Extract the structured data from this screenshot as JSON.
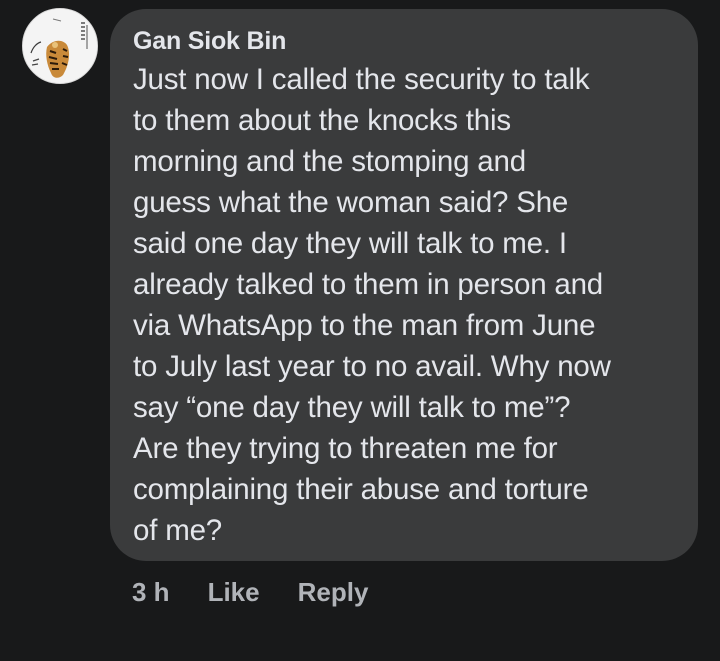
{
  "comment": {
    "author": "Gan Siok Bin",
    "lines": [
      "Just now I called the security to talk",
      "to them about the knocks this",
      "morning and the stomping and",
      "guess what the woman said? She",
      "said one day they will talk to me. I",
      "already talked to them in person and",
      "via WhatsApp to the man from June",
      "to July last year to no avail. Why now",
      "say “one day they will talk to me”?",
      "Are they trying to threaten me for",
      "complaining their abuse and torture",
      "of me?"
    ],
    "timestamp": "3 h",
    "like_label": "Like",
    "reply_label": "Reply"
  },
  "colors": {
    "background": "#18191a",
    "bubble": "#3a3b3c",
    "text": "#e4e6eb",
    "secondary_text": "#b0b3b8"
  },
  "avatar": {
    "icon": "tiger-profile-picture-icon"
  }
}
